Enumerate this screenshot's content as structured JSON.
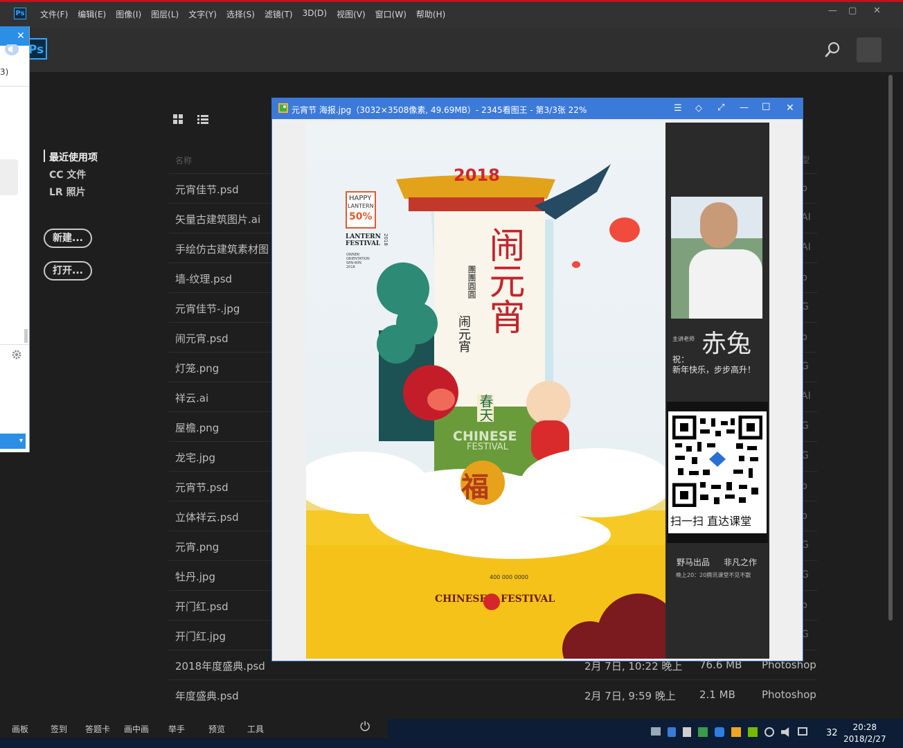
{
  "menubar": {
    "app_icon": "Ps",
    "items": [
      "文件(F)",
      "编辑(E)",
      "图像(I)",
      "图层(L)",
      "文字(Y)",
      "选择(S)",
      "滤镜(T)",
      "3D(D)",
      "视图(V)",
      "窗口(W)",
      "帮助(H)"
    ],
    "controls": [
      "—",
      "▢",
      "✕"
    ]
  },
  "header": {
    "logo": "Ps",
    "icons": [
      "search-icon",
      "account-icon"
    ]
  },
  "sidebar": {
    "items": [
      {
        "label": "最近使用项",
        "active": true
      },
      {
        "label": "CC 文件",
        "active": false
      },
      {
        "label": "LR 照片",
        "active": false
      }
    ],
    "new_button": "新建...",
    "open_button": "打开..."
  },
  "files": {
    "view_icons": [
      "grid-view-icon",
      "list-view-icon"
    ],
    "column_name": "名称",
    "column_type": "型",
    "rows": [
      {
        "name": "元宵佳节.psd",
        "date": "",
        "size": "",
        "type": "",
        "type_tail": "p"
      },
      {
        "name": "矢量古建筑图片.ai",
        "date": "",
        "size": "",
        "type": "",
        "type_tail": "AI"
      },
      {
        "name": "手绘仿古建筑素材图",
        "date": "",
        "size": "",
        "type": "",
        "type_tail": "AI"
      },
      {
        "name": "墙-纹理.psd",
        "date": "",
        "size": "",
        "type": "",
        "type_tail": "p"
      },
      {
        "name": "元宵佳节-.jpg",
        "date": "",
        "size": "",
        "type": "",
        "type_tail": "G"
      },
      {
        "name": "闹元宵.psd",
        "date": "",
        "size": "",
        "type": "",
        "type_tail": "p"
      },
      {
        "name": "灯笼.png",
        "date": "",
        "size": "",
        "type": "",
        "type_tail": "G"
      },
      {
        "name": "祥云.ai",
        "date": "",
        "size": "",
        "type": "",
        "type_tail": "AI"
      },
      {
        "name": "屋檐.png",
        "date": "",
        "size": "",
        "type": "",
        "type_tail": "G"
      },
      {
        "name": "龙宅.jpg",
        "date": "",
        "size": "",
        "type": "",
        "type_tail": "G"
      },
      {
        "name": "元宵节.psd",
        "date": "",
        "size": "",
        "type": "",
        "type_tail": "p"
      },
      {
        "name": "立体祥云.psd",
        "date": "",
        "size": "",
        "type": "",
        "type_tail": "p"
      },
      {
        "name": "元宵.png",
        "date": "",
        "size": "",
        "type": "",
        "type_tail": "G"
      },
      {
        "name": "牡丹.jpg",
        "date": "",
        "size": "",
        "type": "",
        "type_tail": "G"
      },
      {
        "name": "开门红.psd",
        "date": "",
        "size": "",
        "type": "",
        "type_tail": "p"
      },
      {
        "name": "开门红.jpg",
        "date": "",
        "size": "",
        "type": "",
        "type_tail": "G"
      },
      {
        "name": "2018年度盛典.psd",
        "date": "2月 7日, 10:22 晚上",
        "size": "76.6 MB",
        "type": "Photoshop",
        "type_tail": ""
      },
      {
        "name": "年度盛典.psd",
        "date": "2月 7日, 9:59 晚上",
        "size": "2.1 MB",
        "type": "Photoshop",
        "type_tail": ""
      }
    ]
  },
  "popup": {
    "close": "✕",
    "partial_text": "3)",
    "dropdown": "▾"
  },
  "viewer": {
    "title": "元宵节 海报.jpg（3032×3508像素, 49.69MB）- 2345看图王 - 第3/3张 22%",
    "controls": [
      "☰",
      "◇",
      "⤢",
      "—",
      "☐",
      "✕"
    ],
    "poster": {
      "badge_line1": "HAPPY",
      "badge_line2": "LANTERN",
      "badge_pct": "50%",
      "lantern_festival": "LANTERN FESTIVAL",
      "year_small": "2018",
      "side_lines": [
        "OWNER",
        "ORIENTATION",
        "WIN-WIN",
        "2018"
      ],
      "roof_year": "2018",
      "main_title": "闹元宵",
      "small_vertical_1": "團團圓圓",
      "small_vertical_2": "闹元宵",
      "spring": "春天",
      "chinese": "CHINESE",
      "festival": "FESTIVAL",
      "fu": "福",
      "phone": "400 000 0000",
      "footer_left": "CHINESE",
      "footer_right": "FESTIVAL"
    },
    "side": {
      "teacher_label": "主讲老师",
      "teacher_name": "赤兔",
      "wish_label": "祝：",
      "wish_text": "新年快乐，步步高升！",
      "qr_caption": "扫一扫 直达课堂",
      "credit_left": "野马出品",
      "credit_right": "非凡之作",
      "schedule": "晚上20：20腾讯课堂不见不散"
    }
  },
  "appbar": {
    "items": [
      "画板",
      "签到",
      "答题卡",
      "画中画",
      "举手",
      "预览",
      "工具"
    ],
    "power_icon": "⏻"
  },
  "tray": {
    "number": "32",
    "time": "20:28",
    "date": "2018/2/27"
  }
}
